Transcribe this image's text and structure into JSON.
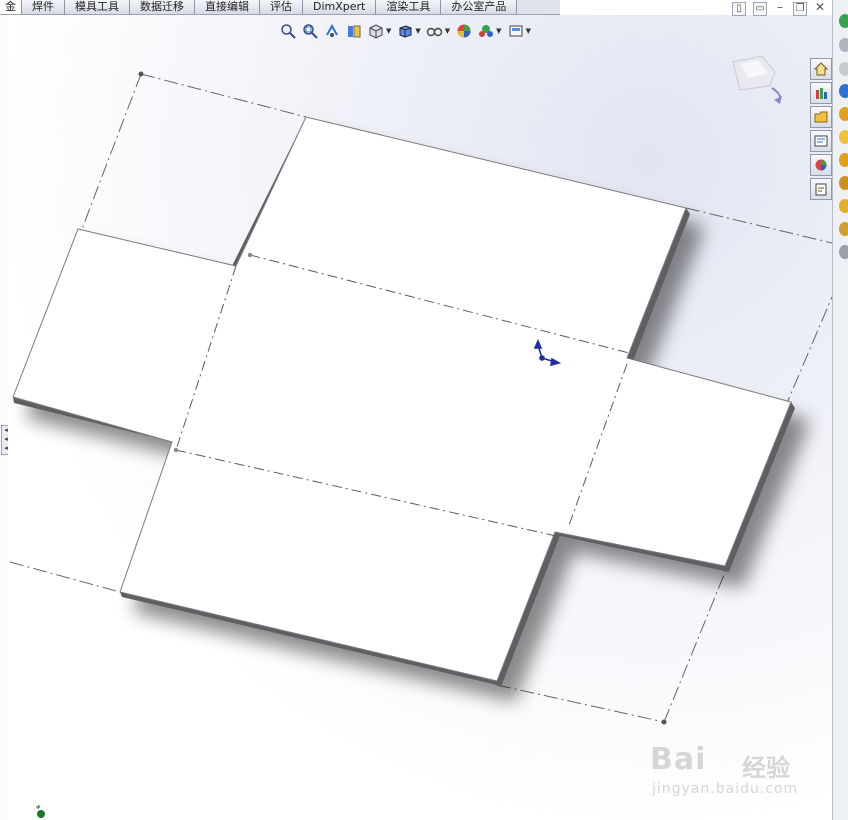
{
  "tabs": [
    {
      "label": "金",
      "active": true
    },
    {
      "label": "焊件",
      "active": false
    },
    {
      "label": "模具工具",
      "active": false
    },
    {
      "label": "数据迁移",
      "active": false
    },
    {
      "label": "直接编辑",
      "active": false
    },
    {
      "label": "评估",
      "active": false
    },
    {
      "label": "DimXpert",
      "active": false
    },
    {
      "label": "渲染工具",
      "active": false
    },
    {
      "label": "办公室产品",
      "active": false
    }
  ],
  "view_toolbar": {
    "icons": [
      "zoom-to-fit-icon",
      "zoom-to-area-icon",
      "previous-view-icon",
      "section-view-icon",
      "view-orientation-icon",
      "display-style-icon",
      "hide-show-items-icon",
      "edit-appearance-icon",
      "apply-scene-icon",
      "view-settings-icon"
    ]
  },
  "task_pane": {
    "icons": [
      "home-icon",
      "resources-icon",
      "design-library-icon",
      "file-explorer-icon",
      "appearances-icon",
      "custom-properties-icon"
    ]
  },
  "colors": {
    "sheet_fill": "#ffffff",
    "sheet_edge": "#6f6f74",
    "bend_line": "#555555",
    "triad_blue": "#1f2fa0",
    "accent": "#2f6fd6"
  },
  "watermark": {
    "brand": "Bai",
    "brand_cn": "经验",
    "url": "jingyan.baidu.com"
  }
}
